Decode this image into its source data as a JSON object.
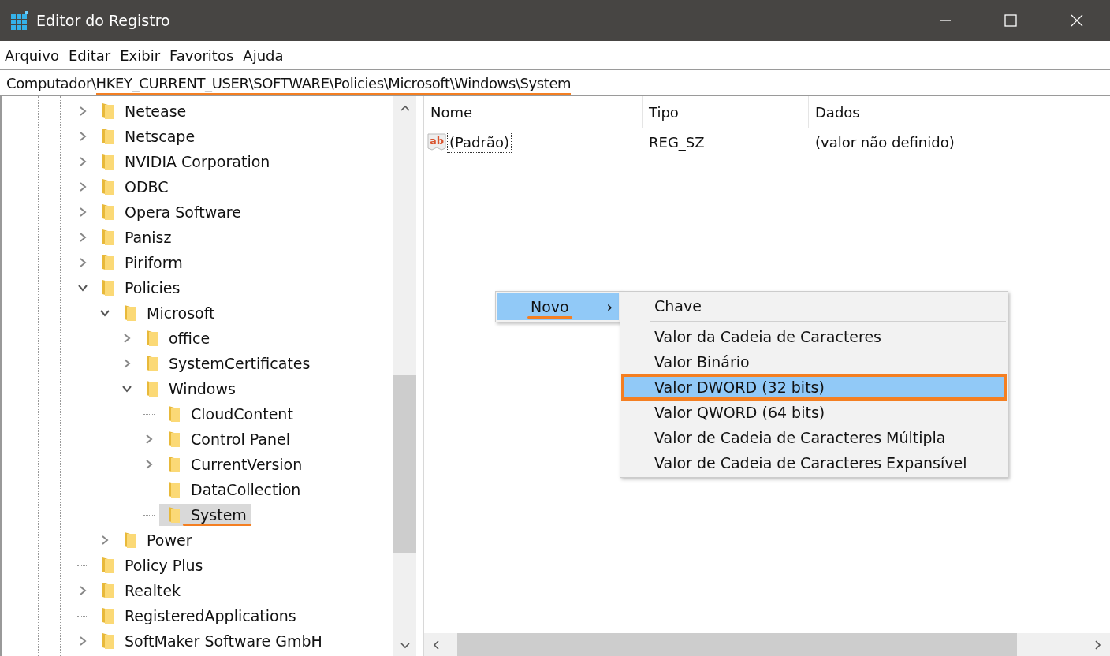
{
  "window": {
    "title": "Editor do Registro"
  },
  "menu": [
    "Arquivo",
    "Editar",
    "Exibir",
    "Favoritos",
    "Ajuda"
  ],
  "address": [
    {
      "text": "Computador\\",
      "annotated": false
    },
    {
      "text": "HKEY_CURRENT_USER\\SOFTWARE\\",
      "annotated": true
    },
    {
      "text": "Policies\\Microsoft\\Windows\\System",
      "annotated": true
    }
  ],
  "tree": {
    "items": [
      {
        "label": "Netease",
        "kind": "branch",
        "expanded": false,
        "selected": false,
        "annotated": false
      },
      {
        "label": "Netscape",
        "kind": "branch",
        "expanded": false,
        "selected": false,
        "annotated": false
      },
      {
        "label": "NVIDIA Corporation",
        "kind": "branch",
        "expanded": false,
        "selected": false,
        "annotated": false
      },
      {
        "label": "ODBC",
        "kind": "branch",
        "expanded": false,
        "selected": false,
        "annotated": false
      },
      {
        "label": "Opera Software",
        "kind": "branch",
        "expanded": false,
        "selected": false,
        "annotated": false
      },
      {
        "label": "Panisz",
        "kind": "branch",
        "expanded": false,
        "selected": false,
        "annotated": false
      },
      {
        "label": "Piriform",
        "kind": "branch",
        "expanded": false,
        "selected": false,
        "annotated": false
      },
      {
        "label": "Policies",
        "kind": "branch",
        "expanded": true,
        "selected": false,
        "annotated": false,
        "children": [
          {
            "label": "Microsoft",
            "kind": "branch",
            "expanded": true,
            "selected": false,
            "annotated": false,
            "children": [
              {
                "label": "office",
                "kind": "branch",
                "expanded": false,
                "selected": false,
                "annotated": false
              },
              {
                "label": "SystemCertificates",
                "kind": "branch",
                "expanded": false,
                "selected": false,
                "annotated": false
              },
              {
                "label": "Windows",
                "kind": "branch",
                "expanded": true,
                "selected": false,
                "annotated": false,
                "children": [
                  {
                    "label": "CloudContent",
                    "kind": "leaf",
                    "selected": false,
                    "annotated": false
                  },
                  {
                    "label": "Control Panel",
                    "kind": "branch",
                    "expanded": false,
                    "selected": false,
                    "annotated": false
                  },
                  {
                    "label": "CurrentVersion",
                    "kind": "branch",
                    "expanded": false,
                    "selected": false,
                    "annotated": false
                  },
                  {
                    "label": "DataCollection",
                    "kind": "leaf",
                    "selected": false,
                    "annotated": false
                  },
                  {
                    "label": "System",
                    "kind": "leaf",
                    "selected": true,
                    "annotated": true
                  }
                ]
              }
            ]
          },
          {
            "label": "Power",
            "kind": "branch",
            "expanded": false,
            "selected": false,
            "annotated": false
          }
        ]
      },
      {
        "label": "Policy Plus",
        "kind": "leaf",
        "selected": false,
        "annotated": false
      },
      {
        "label": "Realtek",
        "kind": "branch",
        "expanded": false,
        "selected": false,
        "annotated": false
      },
      {
        "label": "RegisteredApplications",
        "kind": "leaf",
        "selected": false,
        "annotated": false
      },
      {
        "label": "SoftMaker Software GmbH",
        "kind": "branch",
        "expanded": false,
        "selected": false,
        "annotated": false
      }
    ]
  },
  "values": {
    "columns": [
      "Nome",
      "Tipo",
      "Dados"
    ],
    "rows": [
      {
        "icon": "ab",
        "name": "(Padrão)",
        "type": "REG_SZ",
        "data": "(valor não definido)"
      }
    ]
  },
  "context_menu": {
    "items": [
      {
        "label": "Novo",
        "arrow": "›",
        "selected": true,
        "annotated": true
      }
    ]
  },
  "submenu": {
    "items": [
      {
        "label": "Chave",
        "kind": "item",
        "selected": false,
        "annotated": false
      },
      {
        "kind": "separator"
      },
      {
        "label": "Valor da Cadeia de Caracteres",
        "kind": "item",
        "selected": false,
        "annotated": false
      },
      {
        "label": "Valor Binário",
        "kind": "item",
        "selected": false,
        "annotated": false
      },
      {
        "label": "Valor DWORD (32 bits)",
        "kind": "item",
        "selected": true,
        "annotated": true
      },
      {
        "label": "Valor QWORD (64 bits)",
        "kind": "item",
        "selected": false,
        "annotated": false
      },
      {
        "label": "Valor de Cadeia de Caracteres Múltipla",
        "kind": "item",
        "selected": false,
        "annotated": false
      },
      {
        "label": "Valor de Cadeia de Caracteres Expansível",
        "kind": "item",
        "selected": false,
        "annotated": false
      }
    ]
  }
}
